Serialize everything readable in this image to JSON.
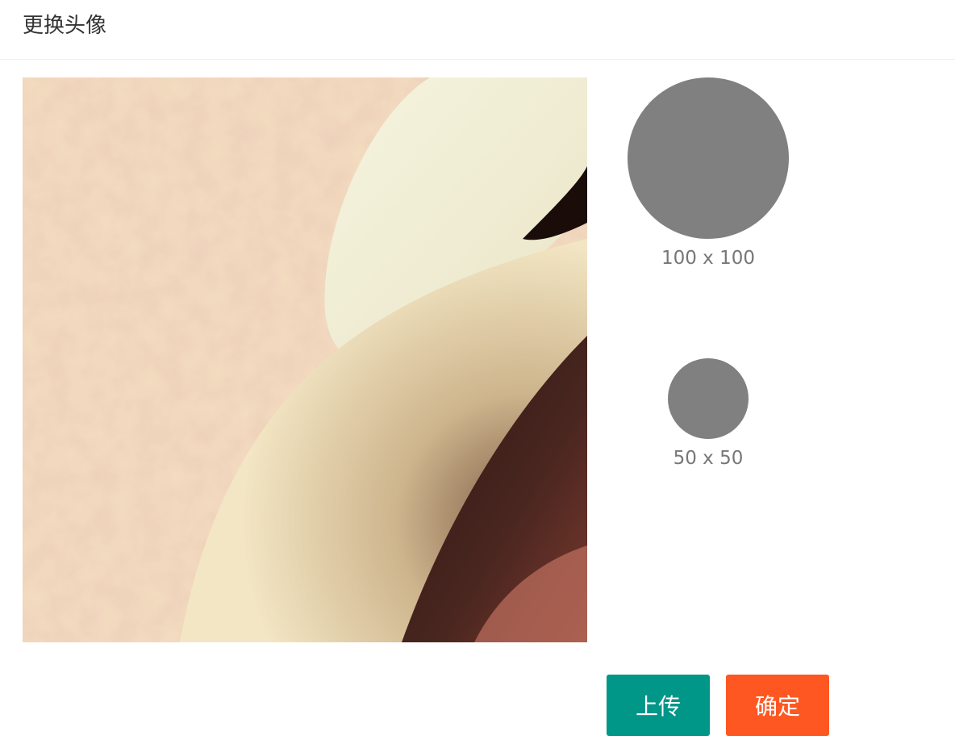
{
  "dialog": {
    "title": "更换头像"
  },
  "previews": {
    "large_label": "100 x 100",
    "small_label": "50 x 50",
    "placeholder_color": "#808080"
  },
  "actions": {
    "upload_label": "上传",
    "confirm_label": "确定",
    "upload_color": "#009688",
    "confirm_color": "#ff5722"
  }
}
